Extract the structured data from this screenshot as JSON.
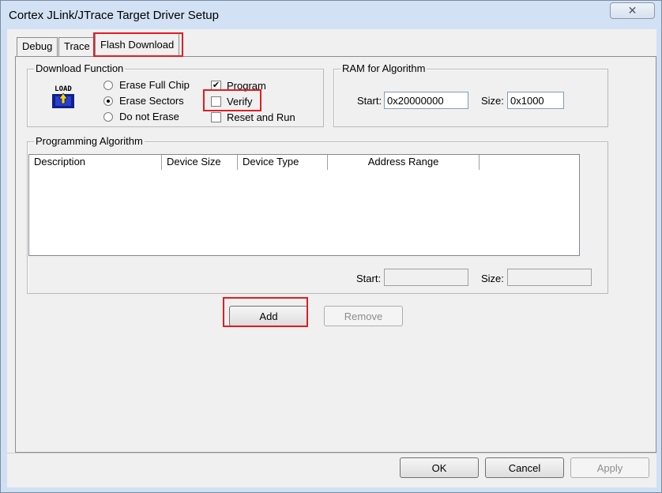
{
  "window": {
    "title": "Cortex JLink/JTrace Target Driver Setup",
    "close_glyph": "✕"
  },
  "tabs": [
    {
      "label": "Debug"
    },
    {
      "label": "Trace"
    },
    {
      "label": "Flash Download"
    }
  ],
  "download_function": {
    "label": "Download Function",
    "icon_text": "LOAD",
    "options": [
      {
        "label": "Erase Full Chip",
        "checked": false
      },
      {
        "label": "Erase Sectors",
        "checked": true
      },
      {
        "label": "Do not Erase",
        "checked": false
      }
    ],
    "checks": [
      {
        "label": "Program",
        "checked": true
      },
      {
        "label": "Verify",
        "checked": false
      },
      {
        "label": "Reset and Run",
        "checked": false
      }
    ]
  },
  "ram_for_algorithm": {
    "label": "RAM for Algorithm",
    "start_label": "Start:",
    "start_value": "0x20000000",
    "size_label": "Size:",
    "size_value": "0x1000"
  },
  "programming_algorithm": {
    "label": "Programming Algorithm",
    "columns": [
      "Description",
      "Device Size",
      "Device Type",
      "Address Range"
    ],
    "rows": [],
    "start_label": "Start:",
    "start_value": "",
    "size_label": "Size:",
    "size_value": ""
  },
  "algorithm_buttons": {
    "add": "Add",
    "remove": "Remove"
  },
  "dialog_buttons": {
    "ok": "OK",
    "cancel": "Cancel",
    "apply": "Apply"
  },
  "colors": {
    "highlight": "#e31c23"
  }
}
